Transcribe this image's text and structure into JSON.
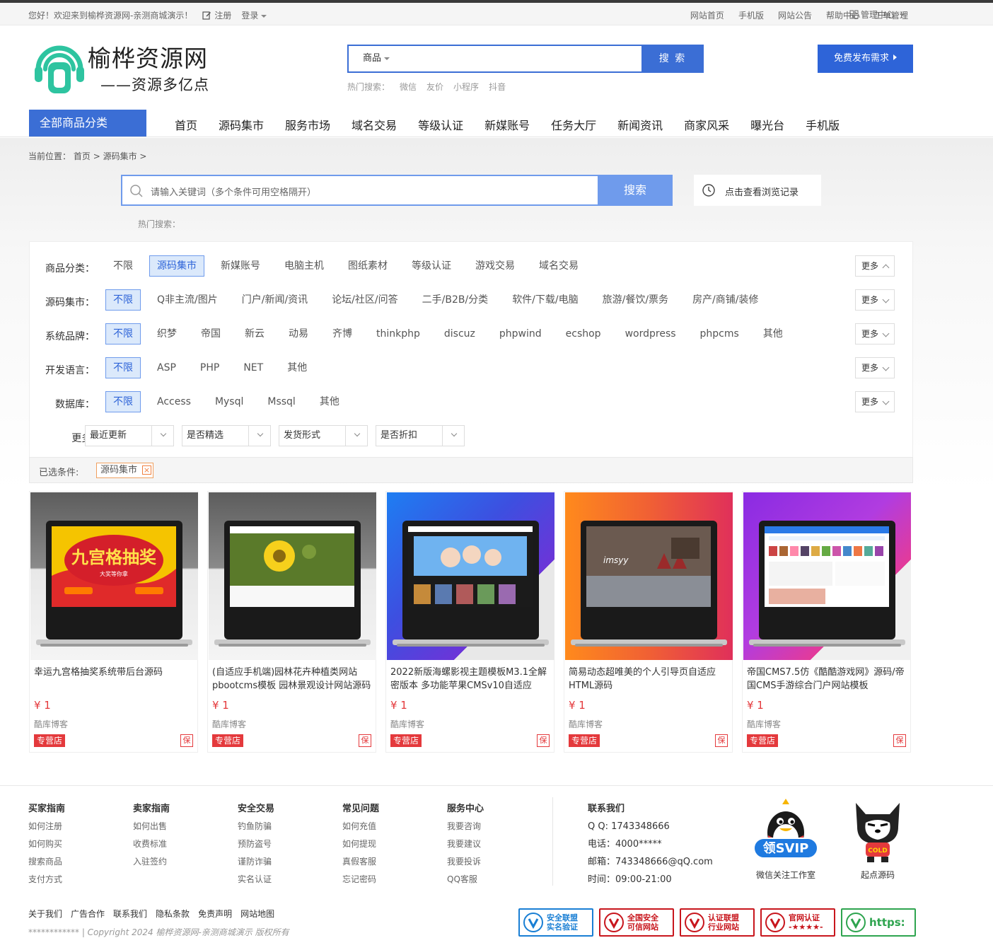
{
  "topbar": {
    "welcome": "您好！欢迎来到榆桦资源网-亲测商城演示！",
    "register": "注册",
    "login": "登录",
    "links": [
      "网站首页",
      "手机版",
      "网站公告",
      "帮助中心",
      "工单管理"
    ],
    "admin": "管理中心"
  },
  "header": {
    "logo_name": "榆桦资源网",
    "logo_slogan": "——资源多亿点",
    "search_type": "商品",
    "search_button": "搜 索",
    "hot_label": "热门搜索：",
    "hot_terms": [
      "微信",
      "友价",
      "小程序",
      "抖音"
    ],
    "publish_button": "免费发布需求"
  },
  "nav": {
    "category_label": "全部商品分类",
    "items": [
      "首页",
      "源码集市",
      "服务市场",
      "域名交易",
      "等级认证",
      "新媒账号",
      "任务大厅",
      "新闻资讯",
      "商家风采",
      "曝光台",
      "手机版"
    ]
  },
  "breadcrumb": {
    "prefix": "当前位置：",
    "items": [
      "首页",
      "源码集市"
    ],
    "sep": ">"
  },
  "search": {
    "placeholder": "请输入关键词（多个条件可用空格隔开）",
    "button": "搜索",
    "history": "点击查看浏览记录",
    "hot_label": "热门搜索："
  },
  "filters": {
    "rows": [
      {
        "label": "商品分类：",
        "options": [
          "不限",
          "源码集市",
          "新媒账号",
          "电脑主机",
          "图纸素材",
          "等级认证",
          "游戏交易",
          "域名交易"
        ],
        "selected": 1
      },
      {
        "label": "源码集市：",
        "options": [
          "不限",
          "Q非主流/图片",
          "门户/新闻/资讯",
          "论坛/社区/问答",
          "二手/B2B/分类",
          "软件/下载/电脑",
          "旅游/餐饮/票务",
          "房产/商铺/装修"
        ],
        "selected": 0
      },
      {
        "label": "系统品牌：",
        "options": [
          "不限",
          "织梦",
          "帝国",
          "新云",
          "动易",
          "齐博",
          "thinkphp",
          "discuz",
          "phpwind",
          "ecshop",
          "wordpress",
          "phpcms",
          "其他"
        ],
        "selected": 0
      },
      {
        "label": "开发语言：",
        "options": [
          "不限",
          "ASP",
          "PHP",
          "NET",
          "其他"
        ],
        "selected": 0
      },
      {
        "label": "数据库：",
        "options": [
          "不限",
          "Access",
          "Mysql",
          "Mssql",
          "其他"
        ],
        "selected": 0
      }
    ],
    "more_label": "更多",
    "extra_label": "更多:",
    "dropdowns": [
      "最近更新",
      "是否精选",
      "发货形式",
      "是否折扣"
    ],
    "selected_label": "已选条件:",
    "selected_tag": "源码集市"
  },
  "products": [
    {
      "title": "幸运九宫格抽奖系统带后台源码",
      "price": "¥ 1",
      "shop": "酷库博客",
      "badge": "专营店",
      "guarantee": "保",
      "screen_text": "九宫格抽奖",
      "screen_sub": "大奖等你拿"
    },
    {
      "title": "(自适应手机端)园林花卉种植类网站pbootcms模板 园林景观设计网站源码",
      "price": "¥ 1",
      "shop": "酷库博客",
      "badge": "专营店",
      "guarantee": "保"
    },
    {
      "title": "2022新版海螺影视主题模板M3.1全解密版本 多功能苹果CMSv10自适应",
      "price": "¥ 1",
      "shop": "酷库博客",
      "badge": "专营店",
      "guarantee": "保"
    },
    {
      "title": "简易动态超唯美的个人引导页自适应HTML源码",
      "price": "¥ 1",
      "shop": "酷库博客",
      "badge": "专营店",
      "guarantee": "保",
      "screen_text": "imsyy"
    },
    {
      "title": "帝国CMS7.5仿《酷酷游戏网》源码/帝国CMS手游综合门户网站模板",
      "price": "¥ 1",
      "shop": "酷库博客",
      "badge": "专营店",
      "guarantee": "保"
    }
  ],
  "footer": {
    "columns": [
      {
        "title": "买家指南",
        "items": [
          "如何注册",
          "如何购买",
          "搜索商品",
          "支付方式"
        ]
      },
      {
        "title": "卖家指南",
        "items": [
          "如何出售",
          "收费标准",
          "入驻签约"
        ]
      },
      {
        "title": "安全交易",
        "items": [
          "钓鱼防骗",
          "预防盗号",
          "谨防诈骗",
          "实名认证"
        ]
      },
      {
        "title": "常见问题",
        "items": [
          "如何充值",
          "如何提现",
          "真假客服",
          "忘记密码"
        ]
      },
      {
        "title": "服务中心",
        "items": [
          "我要咨询",
          "我要建议",
          "我要投诉",
          "QQ客服"
        ]
      }
    ],
    "contact": {
      "title": "联系我们",
      "qq": "Q Q: 1743348666",
      "phone": "电话：4000*****",
      "email": "邮箱：743348666@qQ.com",
      "hours": "时间：09:00-21:00"
    },
    "qr1_label": "微信关注工作室",
    "qr1_badge": "领SVIP",
    "qr2_label": "起点源码",
    "qr2_badge": "COLD",
    "links": [
      "关于我们",
      "广告合作",
      "联系我们",
      "隐私条款",
      "免责声明",
      "网站地图"
    ],
    "copyright": "************ | Copyright 2024 榆桦资源网-亲测商城演示 版权所有",
    "certs": [
      {
        "line1": "安全联盟",
        "line2": "实名验证",
        "color": "#1a7fd4"
      },
      {
        "line1": "全国安全",
        "line2": "可信网站",
        "color": "#c8161d"
      },
      {
        "line1": "认证联盟",
        "line2": "行业网站",
        "color": "#c8161d"
      },
      {
        "line1": "官网认证",
        "line2": "-★★★★-",
        "color": "#c8161d"
      },
      {
        "line1": "https:",
        "line2": "",
        "color": "#2ea44f"
      }
    ]
  }
}
